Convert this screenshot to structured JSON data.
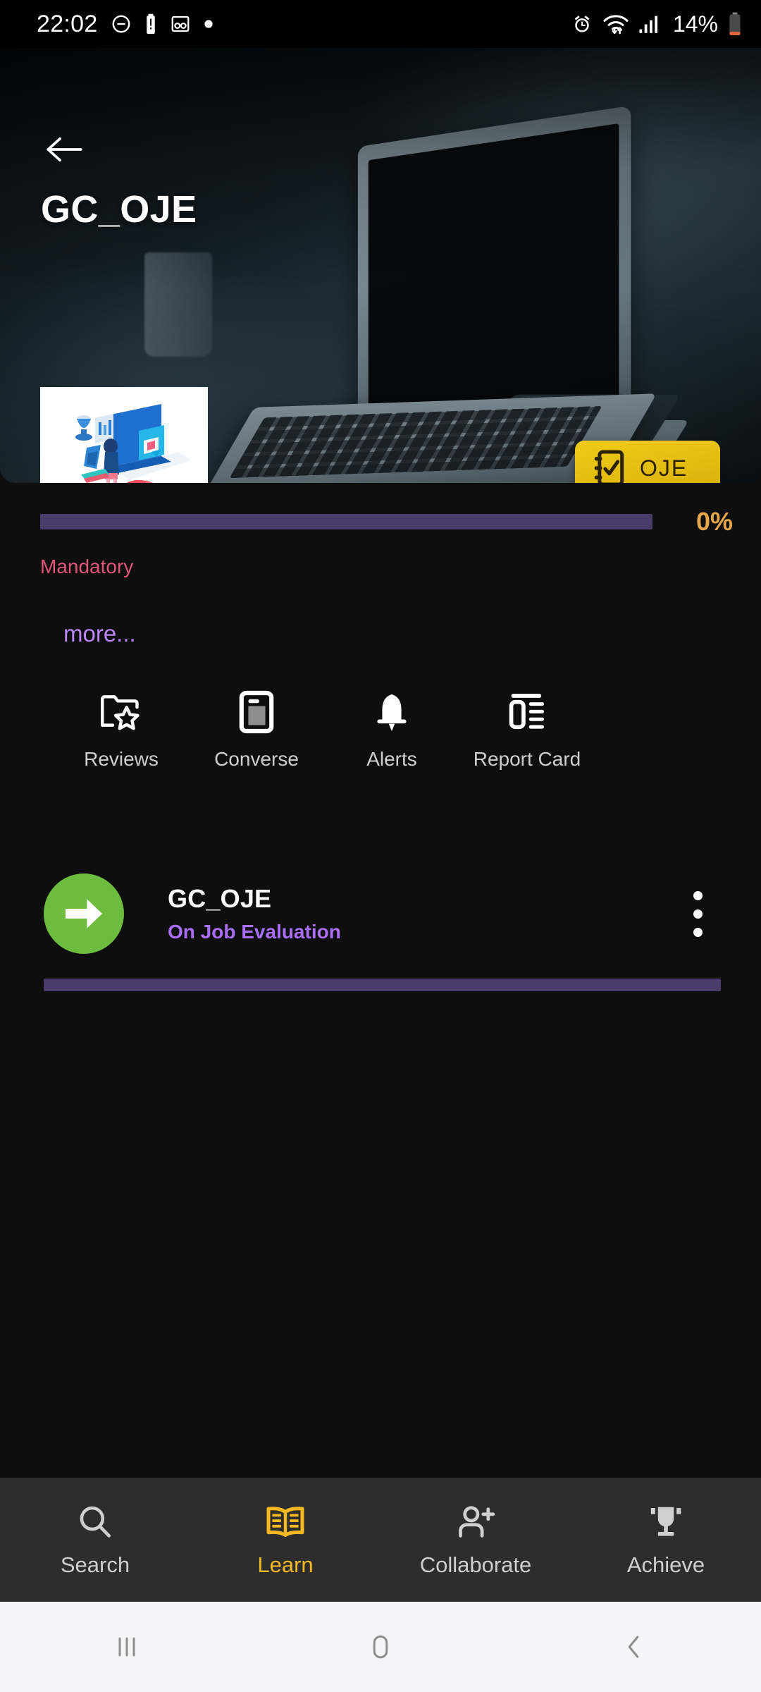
{
  "status_bar": {
    "time": "22:02",
    "battery_text": "14%",
    "icons": [
      "dnd-icon",
      "battery-alert-icon",
      "voicemail-icon",
      "dot-icon",
      "alarm-icon",
      "wifi-icon",
      "signal-icon",
      "battery-low-icon"
    ]
  },
  "hero": {
    "back_icon": "back-arrow-icon",
    "title": "GC_OJE",
    "thumbnail_alt": "course-thumbnail",
    "badge": {
      "label": "OJE",
      "icon": "checklist-check-icon",
      "color": "#e2bb10"
    }
  },
  "progress": {
    "percent_label": "0%",
    "value": 0,
    "track_color": "#4b3b6b",
    "percent_color": "#e6a84b"
  },
  "meta": {
    "mandatory_label": "Mandatory",
    "mandatory_color": "#e0557a",
    "more_label": "more...",
    "more_color": "#bb86fc"
  },
  "actions": [
    {
      "label": "Reviews",
      "icon": "folder-star-icon"
    },
    {
      "label": "Converse",
      "icon": "device-chat-icon"
    },
    {
      "label": "Alerts",
      "icon": "bell-icon"
    },
    {
      "label": "Report Card",
      "icon": "report-card-icon"
    }
  ],
  "lesson": {
    "title": "GC_OJE",
    "subtitle": "On Job Evaluation",
    "subtitle_color": "#a96ef5",
    "status_icon": "arrow-right-icon",
    "status_color": "#6cbc40",
    "menu_icon": "kebab-menu-icon"
  },
  "bottom_nav": {
    "active": "Learn",
    "items": [
      {
        "label": "Search",
        "icon": "search-icon",
        "active": false
      },
      {
        "label": "Learn",
        "icon": "open-book-icon",
        "active": true
      },
      {
        "label": "Collaborate",
        "icon": "person-add-icon",
        "active": false
      },
      {
        "label": "Achieve",
        "icon": "trophy-icon",
        "active": false
      }
    ],
    "active_color": "#f5b821",
    "inactive_color": "#cfcfcf"
  },
  "system_nav": {
    "items": [
      {
        "name": "recents-button",
        "icon": "recents-icon"
      },
      {
        "name": "home-button",
        "icon": "home-icon"
      },
      {
        "name": "back-button",
        "icon": "back-chevron-icon"
      }
    ]
  }
}
